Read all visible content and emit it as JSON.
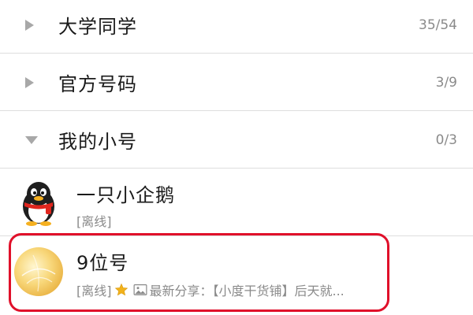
{
  "groups": [
    {
      "name": "大学同学",
      "count": "35/54",
      "state": "collapsed"
    },
    {
      "name": "官方号码",
      "count": "3/9",
      "state": "collapsed"
    },
    {
      "name": "我的小号",
      "count": "0/3",
      "state": "expanded"
    }
  ],
  "contacts": [
    {
      "name": "一只小企鹅",
      "status": "[离线]",
      "avatar_icon": "penguin-icon"
    },
    {
      "name": "9位号",
      "status": "[离线]",
      "share_text": "最新分享：【小度干货铺】后天就...",
      "avatar_icon": "orange-fruit-icon"
    }
  ],
  "colors": {
    "highlight": "#e0102a",
    "star": "#f2b21b"
  }
}
